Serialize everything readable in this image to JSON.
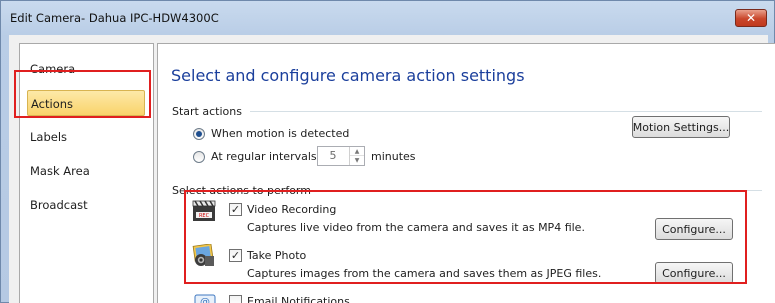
{
  "window": {
    "title": "Edit Camera- Dahua IPC-HDW4300C",
    "close_glyph": "✕"
  },
  "sidebar": {
    "items": [
      {
        "label": "Camera"
      },
      {
        "label": "Actions"
      },
      {
        "label": "Labels"
      },
      {
        "label": "Mask Area"
      },
      {
        "label": "Broadcast"
      }
    ],
    "selected": "Actions"
  },
  "main": {
    "heading": "Select and configure camera action settings",
    "start_actions": {
      "label": "Start actions",
      "option_motion": "When motion is detected",
      "option_interval": "At regular intervals of",
      "interval_value": "5",
      "interval_unit": "minutes",
      "motion_settings_button": "Motion Settings...",
      "selected_option": "When motion is detected"
    },
    "actions": {
      "label": "Select actions to perform",
      "items": [
        {
          "title": "Video Recording",
          "description": "Captures live video from the camera and saves it as MP4 file.",
          "checked": true,
          "configure_label": "Configure...",
          "icon": "video-recording-icon"
        },
        {
          "title": "Take Photo",
          "description": "Captures images from the camera and saves them as JPEG files.",
          "checked": true,
          "configure_label": "Configure...",
          "icon": "take-photo-icon"
        },
        {
          "title": "Email Notifications",
          "checked": false,
          "icon": "email-icon"
        }
      ]
    }
  },
  "colors": {
    "heading": "#1b3f9c",
    "highlight_box": "#e01f1f",
    "selected_nav_bg": "#f9d36b"
  }
}
